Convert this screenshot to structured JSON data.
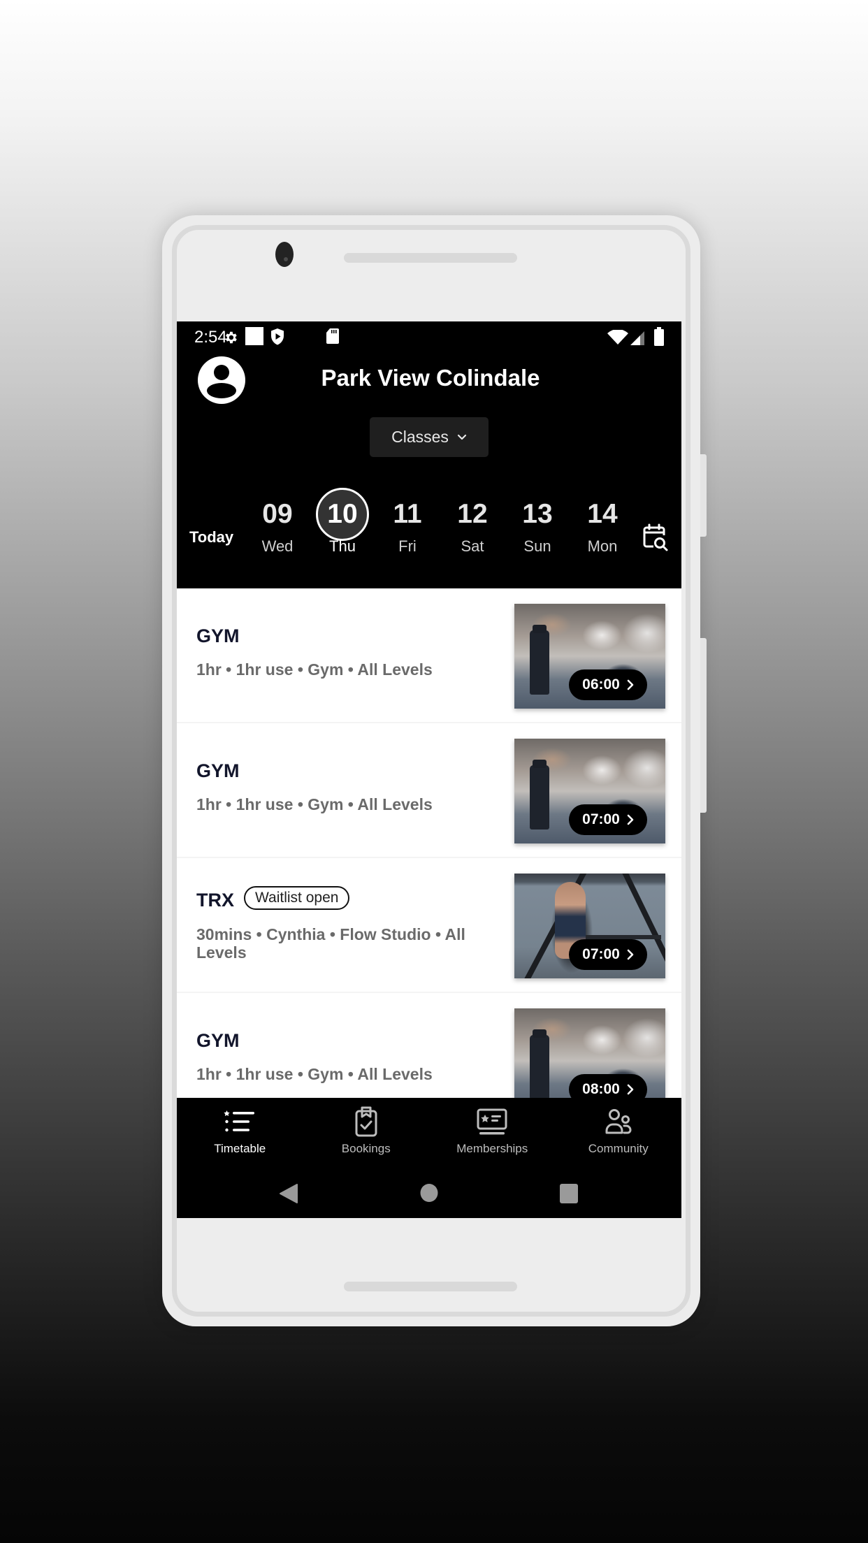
{
  "status_bar": {
    "time": "2:54",
    "left_icons": [
      "settings-gear-icon",
      "white-square-notification-icon",
      "shield-play-icon",
      "sd-card-icon"
    ],
    "right_icons": [
      "wifi-icon",
      "cell-signal-icon",
      "battery-icon"
    ]
  },
  "header": {
    "title": "Park View Colindale",
    "profile_icon": "account-circle-icon",
    "category_dropdown": {
      "selected": "Classes",
      "icon": "chevron-down-icon"
    }
  },
  "date_strip": {
    "today_label": "Today",
    "days": [
      {
        "num": "09",
        "weekday": "Wed",
        "selected": false
      },
      {
        "num": "10",
        "weekday": "Thu",
        "selected": true
      },
      {
        "num": "11",
        "weekday": "Fri",
        "selected": false
      },
      {
        "num": "12",
        "weekday": "Sat",
        "selected": false
      },
      {
        "num": "13",
        "weekday": "Sun",
        "selected": false
      },
      {
        "num": "14",
        "weekday": "Mon",
        "selected": false
      }
    ],
    "calendar_search_icon": "calendar-search-icon"
  },
  "classes": [
    {
      "name": "GYM",
      "meta": "1hr • 1hr use • Gym • All Levels",
      "badge": null,
      "time": "06:00",
      "image": "gym-bottle-photo"
    },
    {
      "name": "GYM",
      "meta": "1hr • 1hr use • Gym • All Levels",
      "badge": null,
      "time": "07:00",
      "image": "gym-bottle-photo"
    },
    {
      "name": "TRX",
      "meta": "30mins • Cynthia • Flow Studio • All Levels",
      "badge": "Waitlist open",
      "time": "07:00",
      "image": "trx-woman-photo"
    },
    {
      "name": "GYM",
      "meta": "1hr • 1hr use • Gym • All Levels",
      "badge": null,
      "time": "08:00",
      "image": "gym-bottle-photo"
    }
  ],
  "bottom_nav": [
    {
      "label": "Timetable",
      "icon": "timetable-list-icon",
      "active": true
    },
    {
      "label": "Bookings",
      "icon": "bookings-clipboard-icon",
      "active": false
    },
    {
      "label": "Memberships",
      "icon": "membership-card-icon",
      "active": false
    },
    {
      "label": "Community",
      "icon": "community-people-icon",
      "active": false
    }
  ],
  "system_nav": [
    "back-icon",
    "home-icon",
    "recents-icon"
  ],
  "colors": {
    "header_bg": "#000000",
    "selected_day_bg": "#333333",
    "class_name": "#12152b",
    "class_meta": "#6a6a6a",
    "nav_active": "#ffffff",
    "nav_inactive": "#bdbdbd"
  }
}
